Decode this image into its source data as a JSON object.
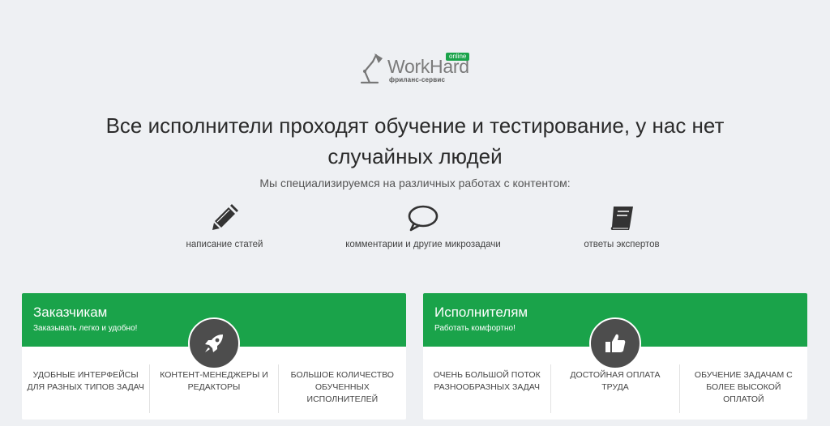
{
  "logo": {
    "wordmark": "WorkHard",
    "badge": "online",
    "tagline": "фриланс-сервис",
    "icon": "desk-lamp-icon"
  },
  "headline": "Все исполнители проходят обучение и тестирование, у нас нет случайных людей",
  "subhead": "Мы специализируемся на различных работах с контентом:",
  "specialties": [
    {
      "icon": "pencil-icon",
      "label": "написание статей"
    },
    {
      "icon": "speech-bubble-icon",
      "label": "комментарии и другие микрозадачи"
    },
    {
      "icon": "book-icon",
      "label": "ответы экспертов"
    }
  ],
  "cards": [
    {
      "title": "Заказчикам",
      "subtitle": "Заказывать легко и удобно!",
      "icon": "rocket-icon",
      "features": [
        "Удобные интерфейсы для разных типов задач",
        "Контент-менеджеры и редакторы",
        "Большое количество обученных исполнителей"
      ]
    },
    {
      "title": "Исполнителям",
      "subtitle": "Работать комфортно!",
      "icon": "thumbs-up-icon",
      "features": [
        "Очень большой поток разнообразных задач",
        "Достойная оплата труда",
        "Обучение задачам с более высокой оплатой"
      ]
    }
  ],
  "colors": {
    "brand_green": "#1aa34a",
    "background": "#eef0f3",
    "badge_dark": "#4d4d4d"
  }
}
